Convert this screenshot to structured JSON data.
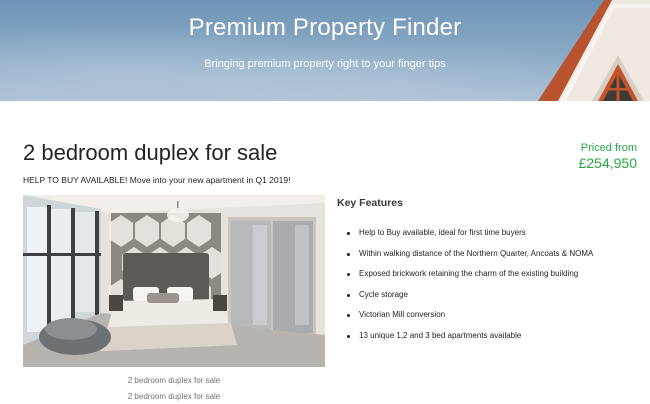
{
  "hero": {
    "title": "Premium Property Finder",
    "subtitle": "Bringing premium property right to your finger tips"
  },
  "listing": {
    "title": "2 bedroom duplex for sale",
    "promo": "HELP TO BUY AVAILABLE! Move into your new apartment in Q1 2019!",
    "price_label": "Priced from",
    "price": "£254,950",
    "price_color": "#28a745"
  },
  "gallery": {
    "captions": [
      "2 bedroom duplex for sale",
      "2 bedroom duplex for sale"
    ]
  },
  "features": {
    "heading": "Key Features",
    "items": [
      "Help to Buy available, ideal for first time buyers",
      "Within walking distance of the Northern Quarter, Ancoats & NOMA",
      "Exposed brickwork retaining the charm of the existing building",
      "Cycle storage",
      "Victorian Mill conversion",
      "13 unique 1,2 and 3 bed apartments available"
    ]
  }
}
